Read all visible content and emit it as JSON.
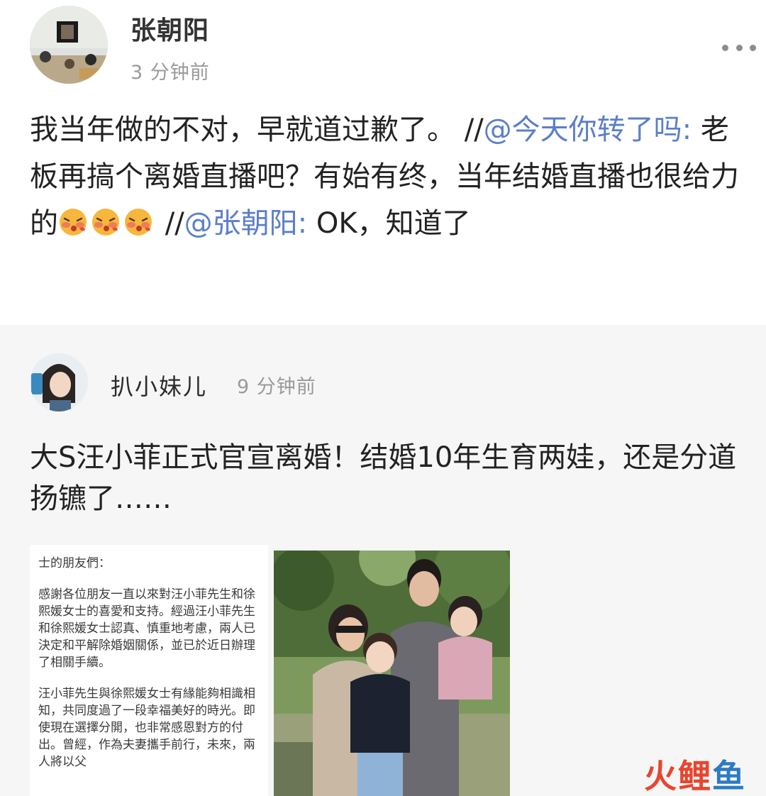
{
  "post": {
    "author": "张朝阳",
    "time": "3 分钟前",
    "text_part1": "我当年做的不对，早就道过歉了。 //",
    "mention1": "@今天你转了吗:",
    "text_part2": " 老板再搞个离婚直播吧？有始有终，当年结婚直播也很给力的",
    "text_part3": " //",
    "mention2": "@张朝阳:",
    "text_part4": " OK，知道了",
    "emoji_icon": "blushing-kiss-emoji"
  },
  "repost": {
    "author": "扒小妹儿",
    "time": "9 分钟前",
    "text": "大S汪小菲正式官宣离婚！结婚10年生育两娃，还是分道扬镳了……",
    "statement": {
      "greeting": "士的朋友們：",
      "paragraph1": "感謝各位朋友一直以來對汪小菲先生和徐熙媛女士的喜愛和支持。經過汪小菲先生和徐熙媛女士認真、慎重地考慮，兩人已決定和平解除婚姻關係，並已於近日辦理了相關手續。",
      "paragraph2": "汪小菲先生與徐熙媛女士有緣能夠相識相知，共同度過了一段幸福美好的時光。即使現在選擇分開，也非常感恩對方的付出。曾經，作為夫妻攜手前行，未來，兩人將以父"
    }
  },
  "watermark": {
    "text1": "火",
    "text2": "鲤",
    "text3": "鱼"
  },
  "colors": {
    "mention": "#5b7fc8",
    "meta_text": "#9a9a9a",
    "repost_background": "#f6f6f6"
  }
}
